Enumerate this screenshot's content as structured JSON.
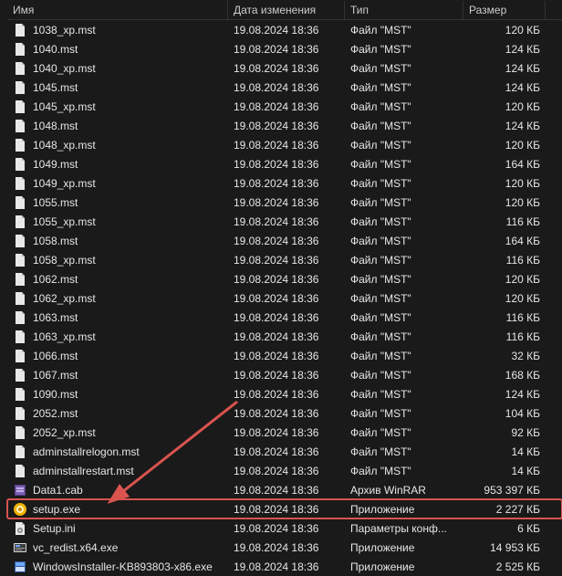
{
  "columns": {
    "name": "Имя",
    "date": "Дата изменения",
    "type": "Тип",
    "size": "Размер"
  },
  "icon_types": {
    "file": "file-icon",
    "rar": "rar-icon",
    "exe_yellow": "exe-yellow-icon",
    "ini": "ini-icon",
    "vcredist": "vcredist-icon",
    "msi": "msi-icon"
  },
  "files": [
    {
      "name": "1038_xp.mst",
      "date": "19.08.2024 18:36",
      "type": "Файл \"MST\"",
      "size": "120 КБ",
      "icon": "file"
    },
    {
      "name": "1040.mst",
      "date": "19.08.2024 18:36",
      "type": "Файл \"MST\"",
      "size": "124 КБ",
      "icon": "file"
    },
    {
      "name": "1040_xp.mst",
      "date": "19.08.2024 18:36",
      "type": "Файл \"MST\"",
      "size": "124 КБ",
      "icon": "file"
    },
    {
      "name": "1045.mst",
      "date": "19.08.2024 18:36",
      "type": "Файл \"MST\"",
      "size": "124 КБ",
      "icon": "file"
    },
    {
      "name": "1045_xp.mst",
      "date": "19.08.2024 18:36",
      "type": "Файл \"MST\"",
      "size": "120 КБ",
      "icon": "file"
    },
    {
      "name": "1048.mst",
      "date": "19.08.2024 18:36",
      "type": "Файл \"MST\"",
      "size": "124 КБ",
      "icon": "file"
    },
    {
      "name": "1048_xp.mst",
      "date": "19.08.2024 18:36",
      "type": "Файл \"MST\"",
      "size": "120 КБ",
      "icon": "file"
    },
    {
      "name": "1049.mst",
      "date": "19.08.2024 18:36",
      "type": "Файл \"MST\"",
      "size": "164 КБ",
      "icon": "file"
    },
    {
      "name": "1049_xp.mst",
      "date": "19.08.2024 18:36",
      "type": "Файл \"MST\"",
      "size": "120 КБ",
      "icon": "file"
    },
    {
      "name": "1055.mst",
      "date": "19.08.2024 18:36",
      "type": "Файл \"MST\"",
      "size": "120 КБ",
      "icon": "file"
    },
    {
      "name": "1055_xp.mst",
      "date": "19.08.2024 18:36",
      "type": "Файл \"MST\"",
      "size": "116 КБ",
      "icon": "file"
    },
    {
      "name": "1058.mst",
      "date": "19.08.2024 18:36",
      "type": "Файл \"MST\"",
      "size": "164 КБ",
      "icon": "file"
    },
    {
      "name": "1058_xp.mst",
      "date": "19.08.2024 18:36",
      "type": "Файл \"MST\"",
      "size": "116 КБ",
      "icon": "file"
    },
    {
      "name": "1062.mst",
      "date": "19.08.2024 18:36",
      "type": "Файл \"MST\"",
      "size": "120 КБ",
      "icon": "file"
    },
    {
      "name": "1062_xp.mst",
      "date": "19.08.2024 18:36",
      "type": "Файл \"MST\"",
      "size": "120 КБ",
      "icon": "file"
    },
    {
      "name": "1063.mst",
      "date": "19.08.2024 18:36",
      "type": "Файл \"MST\"",
      "size": "116 КБ",
      "icon": "file"
    },
    {
      "name": "1063_xp.mst",
      "date": "19.08.2024 18:36",
      "type": "Файл \"MST\"",
      "size": "116 КБ",
      "icon": "file"
    },
    {
      "name": "1066.mst",
      "date": "19.08.2024 18:36",
      "type": "Файл \"MST\"",
      "size": "32 КБ",
      "icon": "file"
    },
    {
      "name": "1067.mst",
      "date": "19.08.2024 18:36",
      "type": "Файл \"MST\"",
      "size": "168 КБ",
      "icon": "file"
    },
    {
      "name": "1090.mst",
      "date": "19.08.2024 18:36",
      "type": "Файл \"MST\"",
      "size": "124 КБ",
      "icon": "file"
    },
    {
      "name": "2052.mst",
      "date": "19.08.2024 18:36",
      "type": "Файл \"MST\"",
      "size": "104 КБ",
      "icon": "file"
    },
    {
      "name": "2052_xp.mst",
      "date": "19.08.2024 18:36",
      "type": "Файл \"MST\"",
      "size": "92 КБ",
      "icon": "file"
    },
    {
      "name": "adminstallrelogon.mst",
      "date": "19.08.2024 18:36",
      "type": "Файл \"MST\"",
      "size": "14 КБ",
      "icon": "file"
    },
    {
      "name": "adminstallrestart.mst",
      "date": "19.08.2024 18:36",
      "type": "Файл \"MST\"",
      "size": "14 КБ",
      "icon": "file"
    },
    {
      "name": "Data1.cab",
      "date": "19.08.2024 18:36",
      "type": "Архив WinRAR",
      "size": "953 397 КБ",
      "icon": "rar"
    },
    {
      "name": "setup.exe",
      "date": "19.08.2024 18:36",
      "type": "Приложение",
      "size": "2 227 КБ",
      "icon": "exe_yellow",
      "highlight": true
    },
    {
      "name": "Setup.ini",
      "date": "19.08.2024 18:36",
      "type": "Параметры конф...",
      "size": "6 КБ",
      "icon": "ini"
    },
    {
      "name": "vc_redist.x64.exe",
      "date": "19.08.2024 18:36",
      "type": "Приложение",
      "size": "14 953 КБ",
      "icon": "vcredist"
    },
    {
      "name": "WindowsInstaller-KB893803-x86.exe",
      "date": "19.08.2024 18:36",
      "type": "Приложение",
      "size": "2 525 КБ",
      "icon": "msi"
    }
  ],
  "annotation": {
    "arrow_color": "#d9534f",
    "highlight_color": "#d9534f"
  }
}
